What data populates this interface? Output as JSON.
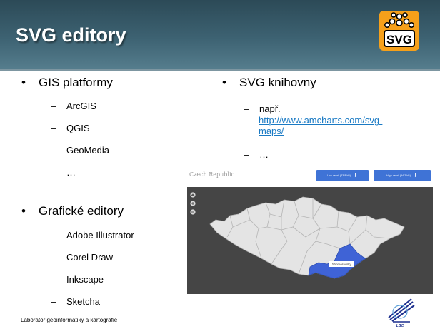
{
  "slide": {
    "title": "SVG editory",
    "logo_text": "SVG",
    "left_column": {
      "group1": {
        "bullet": "GIS platformy",
        "items": [
          "ArcGIS",
          "QGIS",
          "GeoMedia",
          "…"
        ]
      },
      "group2": {
        "bullet": "Grafické editory",
        "items": [
          "Adobe Illustrator",
          "Corel Draw",
          "Inkscape",
          "Sketcha"
        ]
      }
    },
    "right_column": {
      "bullet": "SVG knihovny",
      "item1_prefix": "např.",
      "item1_link": "http://www.amcharts.com/svg-maps/",
      "item1_link_line1": "http://www.amcharts.com/svg-",
      "item1_link_line2": "maps/",
      "item2": "…"
    },
    "map_preview": {
      "title": "Czech Republic",
      "download_low": "Low detail (23.8 kB)",
      "download_high": "High detail (94.2 kB)",
      "highlighted_region_label": "Jihomoravský",
      "zoom_controls": [
        "home-icon",
        "plus-icon",
        "minus-icon"
      ]
    },
    "footer": "Laboratoř geoinformatiky a kartografie",
    "colors": {
      "header": "#3d6272",
      "link": "#1a7ac4",
      "map_background": "#454545",
      "map_region": "#e4e4e4",
      "highlight": "#3f63d6"
    }
  }
}
